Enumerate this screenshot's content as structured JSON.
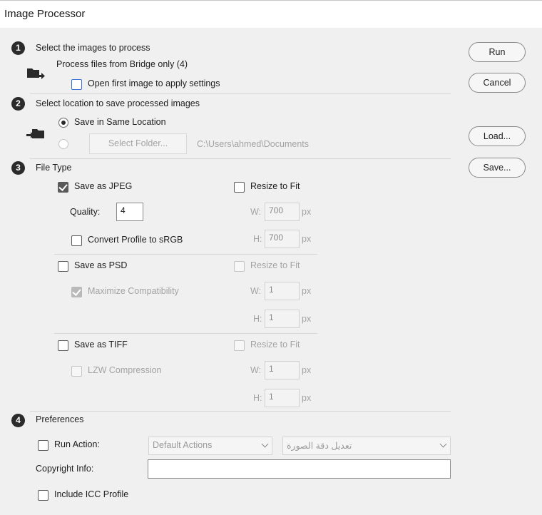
{
  "window": {
    "title": "Image Processor"
  },
  "buttons": {
    "run": "Run",
    "cancel": "Cancel",
    "load": "Load...",
    "save": "Save..."
  },
  "section1": {
    "number": "1",
    "heading": "Select the images to process",
    "source": "Process files from Bridge only (4)",
    "open_first": "Open first image to apply settings",
    "folder_icon": "folder-arrow-icon"
  },
  "section2": {
    "number": "2",
    "heading": "Select location to save processed images",
    "same_location": "Save in Same Location",
    "select_folder": "Select Folder...",
    "path": "C:\\Users\\ahmed\\Documents",
    "folder_icon": "folder-arrow-icon"
  },
  "section3": {
    "number": "3",
    "heading": "File Type",
    "jpeg": {
      "label": "Save as JPEG",
      "checked": true,
      "resize_label": "Resize to Fit",
      "quality_label": "Quality:",
      "quality": "4",
      "convert_label": "Convert Profile to sRGB",
      "w_label": "W:",
      "w": "700",
      "h_label": "H:",
      "h": "700",
      "unit": "px"
    },
    "psd": {
      "label": "Save as PSD",
      "resize_label": "Resize to Fit",
      "max_compat_label": "Maximize Compatibility",
      "w_label": "W:",
      "w": "1",
      "h_label": "H:",
      "h": "1",
      "unit": "px"
    },
    "tiff": {
      "label": "Save as TIFF",
      "resize_label": "Resize to Fit",
      "lzw_label": "LZW Compression",
      "w_label": "W:",
      "w": "1",
      "h_label": "H:",
      "h": "1",
      "unit": "px"
    }
  },
  "section4": {
    "number": "4",
    "heading": "Preferences",
    "run_action": "Run Action:",
    "action_set": "Default Actions",
    "action_name": "تعديل دقة الصورة",
    "copyright_label": "Copyright Info:",
    "copyright_value": "",
    "icc": "Include ICC Profile"
  },
  "colors": {
    "background": "#f0f0f0",
    "titlebar": "#ffffff",
    "step_badge": "#2b2b2b"
  }
}
